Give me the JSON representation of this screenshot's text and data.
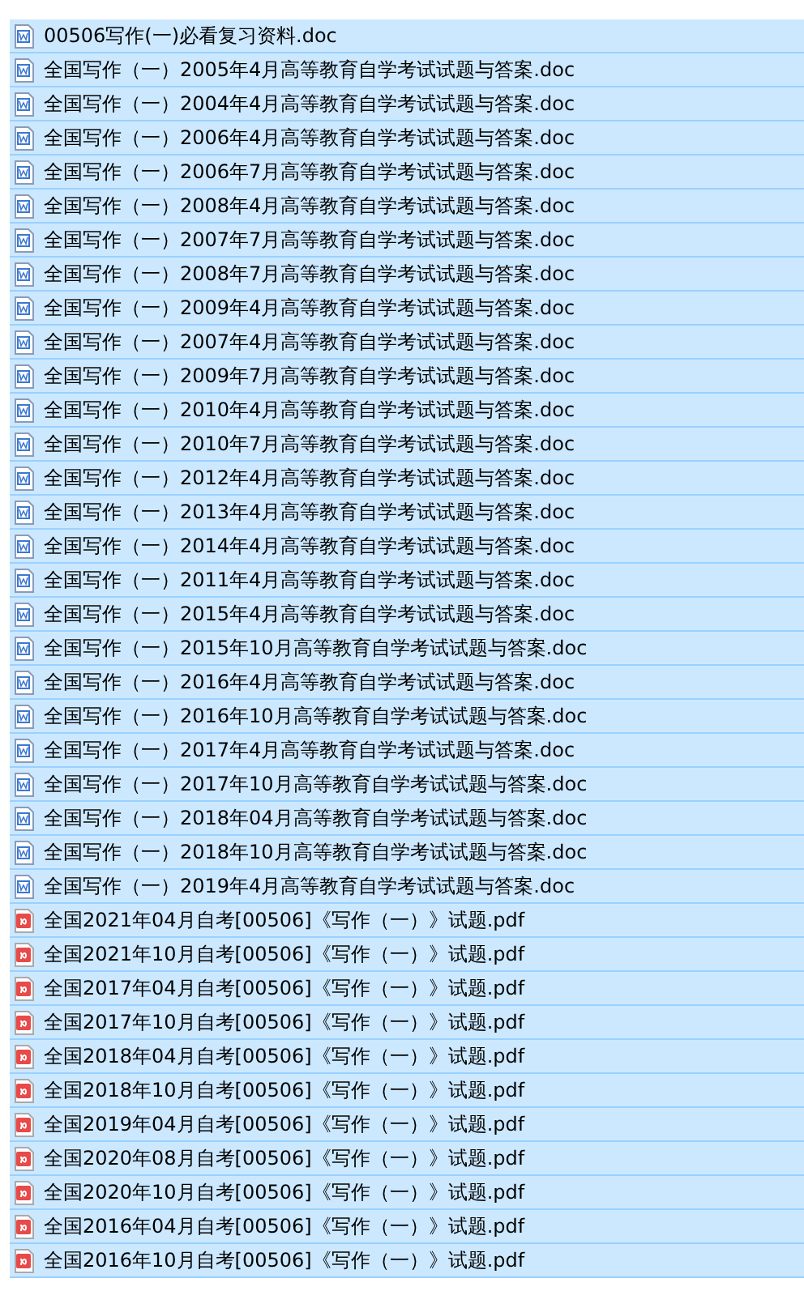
{
  "files": [
    {
      "name": "00506写作(一)必看复习资料.doc",
      "kind": "doc",
      "selected": true
    },
    {
      "name": "全国写作（一）2005年4月高等教育自学考试试题与答案.doc",
      "kind": "doc",
      "selected": true
    },
    {
      "name": "全国写作（一）2004年4月高等教育自学考试试题与答案.doc",
      "kind": "doc",
      "selected": true
    },
    {
      "name": "全国写作（一）2006年4月高等教育自学考试试题与答案.doc",
      "kind": "doc",
      "selected": true
    },
    {
      "name": "全国写作（一）2006年7月高等教育自学考试试题与答案.doc",
      "kind": "doc",
      "selected": true
    },
    {
      "name": "全国写作（一）2008年4月高等教育自学考试试题与答案.doc",
      "kind": "doc",
      "selected": true
    },
    {
      "name": "全国写作（一）2007年7月高等教育自学考试试题与答案.doc",
      "kind": "doc",
      "selected": true
    },
    {
      "name": "全国写作（一）2008年7月高等教育自学考试试题与答案.doc",
      "kind": "doc",
      "selected": true
    },
    {
      "name": "全国写作（一）2009年4月高等教育自学考试试题与答案.doc",
      "kind": "doc",
      "selected": true
    },
    {
      "name": "全国写作（一）2007年4月高等教育自学考试试题与答案.doc",
      "kind": "doc",
      "selected": true
    },
    {
      "name": "全国写作（一）2009年7月高等教育自学考试试题与答案.doc",
      "kind": "doc",
      "selected": true
    },
    {
      "name": "全国写作（一）2010年4月高等教育自学考试试题与答案.doc",
      "kind": "doc",
      "selected": true
    },
    {
      "name": "全国写作（一）2010年7月高等教育自学考试试题与答案.doc",
      "kind": "doc",
      "selected": true
    },
    {
      "name": "全国写作（一）2012年4月高等教育自学考试试题与答案.doc",
      "kind": "doc",
      "selected": true
    },
    {
      "name": "全国写作（一）2013年4月高等教育自学考试试题与答案.doc",
      "kind": "doc",
      "selected": true
    },
    {
      "name": "全国写作（一）2014年4月高等教育自学考试试题与答案.doc",
      "kind": "doc",
      "selected": true
    },
    {
      "name": "全国写作（一）2011年4月高等教育自学考试试题与答案.doc",
      "kind": "doc",
      "selected": true
    },
    {
      "name": "全国写作（一）2015年4月高等教育自学考试试题与答案.doc",
      "kind": "doc",
      "selected": true
    },
    {
      "name": "全国写作（一）2015年10月高等教育自学考试试题与答案.doc",
      "kind": "doc",
      "selected": true
    },
    {
      "name": "全国写作（一）2016年4月高等教育自学考试试题与答案.doc",
      "kind": "doc",
      "selected": true
    },
    {
      "name": "全国写作（一）2016年10月高等教育自学考试试题与答案.doc",
      "kind": "doc",
      "selected": true
    },
    {
      "name": "全国写作（一）2017年4月高等教育自学考试试题与答案.doc",
      "kind": "doc",
      "selected": true
    },
    {
      "name": "全国写作（一）2017年10月高等教育自学考试试题与答案.doc",
      "kind": "doc",
      "selected": true
    },
    {
      "name": "全国写作（一）2018年04月高等教育自学考试试题与答案.doc",
      "kind": "doc",
      "selected": true
    },
    {
      "name": "全国写作（一）2018年10月高等教育自学考试试题与答案.doc",
      "kind": "doc",
      "selected": true
    },
    {
      "name": "全国写作（一）2019年4月高等教育自学考试试题与答案.doc",
      "kind": "doc",
      "selected": true
    },
    {
      "name": "全国2021年04月自考[00506]《写作（一）》试题.pdf",
      "kind": "pdf",
      "selected": true
    },
    {
      "name": "全国2021年10月自考[00506]《写作（一）》试题.pdf",
      "kind": "pdf",
      "selected": true
    },
    {
      "name": "全国2017年04月自考[00506]《写作（一）》试题.pdf",
      "kind": "pdf",
      "selected": true
    },
    {
      "name": "全国2017年10月自考[00506]《写作（一）》试题.pdf",
      "kind": "pdf",
      "selected": true
    },
    {
      "name": "全国2018年04月自考[00506]《写作（一）》试题.pdf",
      "kind": "pdf",
      "selected": true
    },
    {
      "name": "全国2018年10月自考[00506]《写作（一）》试题.pdf",
      "kind": "pdf",
      "selected": true
    },
    {
      "name": "全国2019年04月自考[00506]《写作（一）》试题.pdf",
      "kind": "pdf",
      "selected": true
    },
    {
      "name": "全国2020年08月自考[00506]《写作（一）》试题.pdf",
      "kind": "pdf",
      "selected": true
    },
    {
      "name": "全国2020年10月自考[00506]《写作（一）》试题.pdf",
      "kind": "pdf",
      "selected": true
    },
    {
      "name": "全国2016年04月自考[00506]《写作（一）》试题.pdf",
      "kind": "pdf",
      "selected": true
    },
    {
      "name": "全国2016年10月自考[00506]《写作（一）》试题.pdf",
      "kind": "pdf",
      "selected": true
    }
  ]
}
